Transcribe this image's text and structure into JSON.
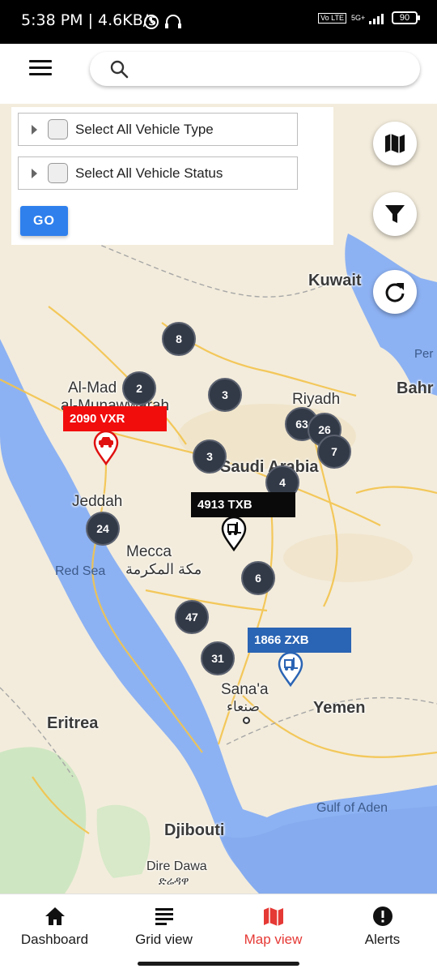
{
  "status_bar": {
    "time": "5:38 PM | 4.6KB/s",
    "network": "5G+",
    "volte": "Vo LTE",
    "battery": "90"
  },
  "header": {
    "menu_icon": "hamburger-menu-icon",
    "search_icon": "search-icon",
    "search_value": "",
    "search_placeholder": ""
  },
  "filters": {
    "vehicle_type_label": "Select All Vehicle Type",
    "vehicle_status_label": "Select All Vehicle Status",
    "go_label": "GO"
  },
  "map_labels": {
    "kuwait": "Kuwait",
    "riyadh": "Riyadh",
    "bahrain": "Bahr",
    "per": "Per",
    "al_madinah_1": "Al-Mad",
    "al_madinah_2": "al-Munawwarah",
    "saudi": "Saudi Arabia",
    "jeddah": "Jeddah",
    "mecca": "Mecca",
    "mecca_ar": "مكة المكرمة",
    "red_sea": "Red Sea",
    "sanaa": "Sana'a",
    "sanaa_ar": "صنعاء",
    "yemen": "Yemen",
    "eritrea": "Eritrea",
    "gulf_aden": "Gulf of Aden",
    "djibouti": "Djibouti",
    "dire_dawa": "Dire Dawa",
    "dire_dawa_am": "ድሬዳዋ"
  },
  "clusters": [
    "8",
    "2",
    "3",
    "63",
    "26",
    "7",
    "3",
    "4",
    "24",
    "6",
    "47",
    "31"
  ],
  "vehicles": [
    {
      "plate": "2090 VXR",
      "color": "#f20d0d"
    },
    {
      "plate": "4913 TXB",
      "color": "#0a0a0a"
    },
    {
      "plate": "1866 ZXB",
      "color": "#2a64b4"
    }
  ],
  "fabs": [
    "map-layers-icon",
    "filter-icon",
    "refresh-icon"
  ],
  "bottom_nav": {
    "items": [
      {
        "label": "Dashboard",
        "icon": "home-icon"
      },
      {
        "label": "Grid view",
        "icon": "list-icon"
      },
      {
        "label": "Map view",
        "icon": "map-icon",
        "active": true
      },
      {
        "label": "Alerts",
        "icon": "alert-icon"
      }
    ],
    "active_color": "#e53935"
  }
}
